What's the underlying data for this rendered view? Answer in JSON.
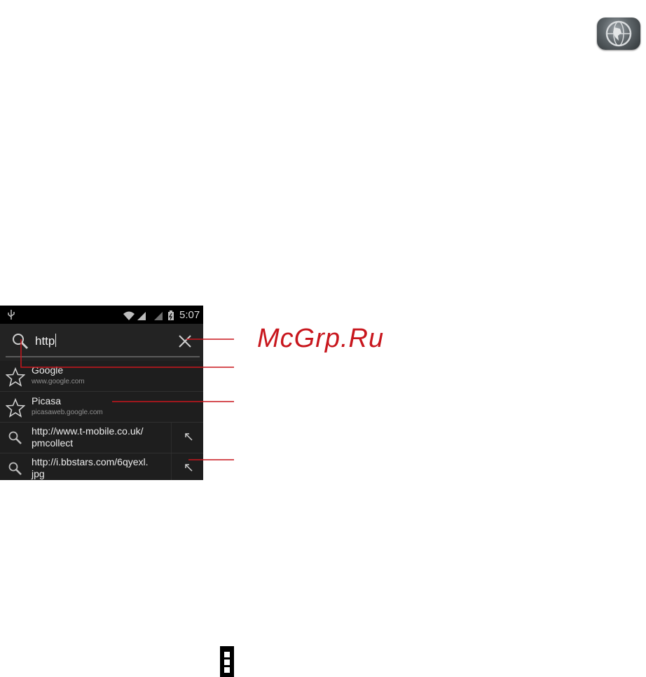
{
  "status_bar": {
    "time": "5:07"
  },
  "search": {
    "query": "http"
  },
  "suggestions": [
    {
      "type": "bookmark",
      "title": "Google",
      "subtitle": "www.google.com"
    },
    {
      "type": "bookmark",
      "title": "Picasa",
      "subtitle": "picasaweb.google.com"
    },
    {
      "type": "search",
      "line1": "http://www.t-mobile.co.uk/",
      "line2": "pmcollect"
    },
    {
      "type": "search",
      "line1": "http://i.bbstars.com/6qyexl.",
      "line2": "jpg"
    }
  ],
  "watermark": "McGrp.Ru",
  "colors": {
    "callout": "#c8161d",
    "phone_bg": "#1c1c1c"
  },
  "icons": [
    "globe-browser-icon",
    "usb-icon",
    "wifi-icon",
    "signal-icon",
    "battery-icon",
    "search-icon",
    "close-icon",
    "star-icon",
    "arrow-up-left-icon",
    "overflow-menu-icon"
  ]
}
